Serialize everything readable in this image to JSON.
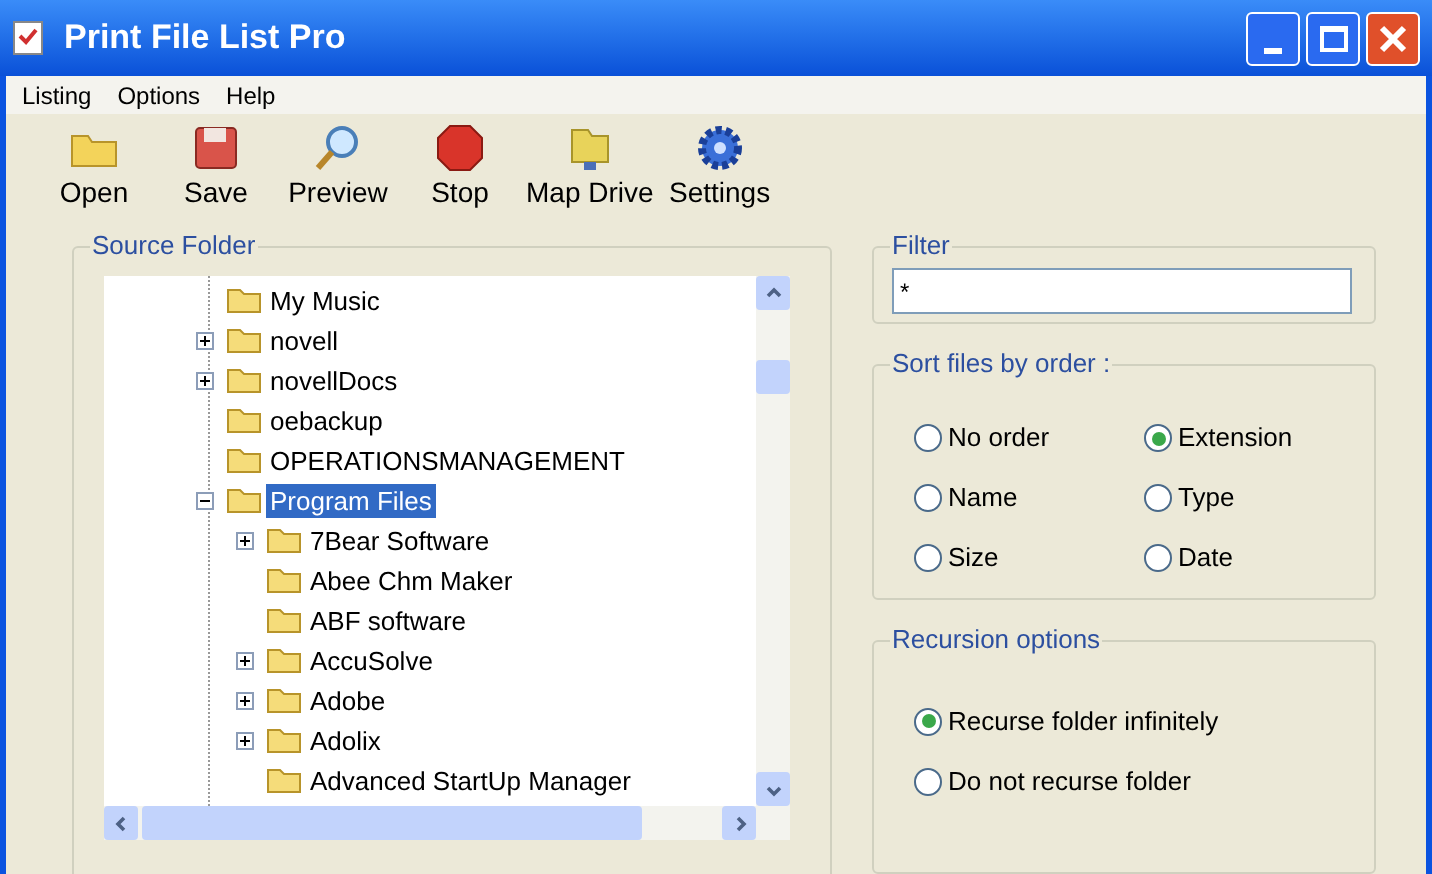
{
  "window": {
    "title": "Print File List Pro"
  },
  "menu": [
    "Listing",
    "Options",
    "Help"
  ],
  "toolbar": [
    "Open",
    "Save",
    "Preview",
    "Stop",
    "Map Drive",
    "Settings"
  ],
  "source_folder": {
    "label": "Source Folder",
    "tree": [
      {
        "name": "My Music",
        "selected": false
      },
      {
        "name": "novell",
        "selected": false,
        "expanded": false
      },
      {
        "name": "novellDocs",
        "selected": false,
        "expanded": false
      },
      {
        "name": "oebackup",
        "selected": false
      },
      {
        "name": "OPERATIONSMANAGEMENT",
        "selected": false
      },
      {
        "name": "Program Files",
        "selected": true,
        "expanded": true,
        "children": [
          {
            "name": "7Bear Software",
            "selected": false,
            "expanded": false
          },
          {
            "name": "Abee Chm Maker",
            "selected": false
          },
          {
            "name": "ABF software",
            "selected": false
          },
          {
            "name": "AccuSolve",
            "selected": false,
            "expanded": false
          },
          {
            "name": "Adobe",
            "selected": false,
            "expanded": false
          },
          {
            "name": "Adolix",
            "selected": false,
            "expanded": false
          },
          {
            "name": "Advanced StartUp Manager",
            "selected": false
          }
        ]
      }
    ]
  },
  "filter": {
    "label": "Filter",
    "value": "*"
  },
  "sort": {
    "label": "Sort files by order :",
    "options": [
      {
        "label": "No order",
        "selected": false
      },
      {
        "label": "Extension",
        "selected": true
      },
      {
        "label": "Name",
        "selected": false
      },
      {
        "label": "Type",
        "selected": false
      },
      {
        "label": "Size",
        "selected": false
      },
      {
        "label": "Date",
        "selected": false
      }
    ]
  },
  "recursion": {
    "label": "Recursion options",
    "options": [
      {
        "label": "Recurse folder infinitely",
        "selected": true
      },
      {
        "label": "Do not recurse folder",
        "selected": false
      }
    ]
  }
}
